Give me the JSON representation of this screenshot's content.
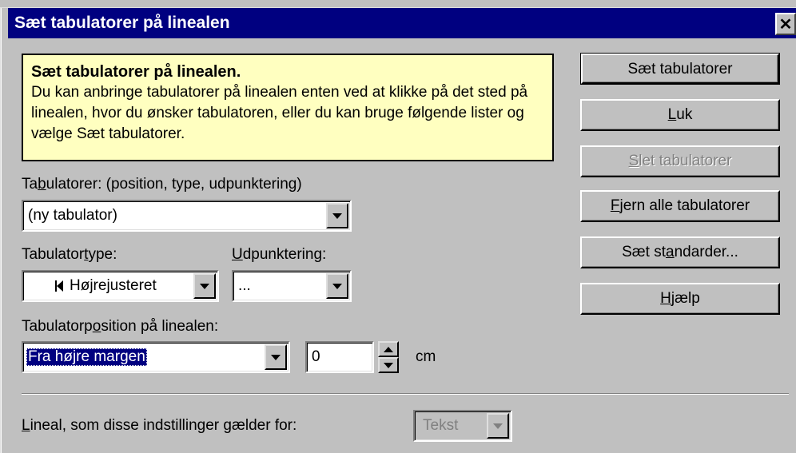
{
  "dialog": {
    "title": "Sæt tabulatorer på linealen",
    "close_label": "✕"
  },
  "tip": {
    "title": "Sæt tabulatorer på linealen.",
    "body": "Du kan anbringe tabulatorer på linealen enten ved at klikke på det sted på linealen, hvor du ønsker tabulatoren, eller du kan bruge følgende lister og vælge Sæt tabulatorer."
  },
  "tabs_list": {
    "label_pre": "Ta",
    "label_u": "b",
    "label_post": "ulatorer: (position, type, udpunktering)",
    "value": "(ny tabulator)"
  },
  "tab_type": {
    "label_pre": "Tabulator",
    "label_u": "t",
    "label_post": "ype:",
    "value": "Højrejusteret"
  },
  "leader": {
    "label_pre": "",
    "label_u": "U",
    "label_post": "dpunktering:",
    "value": "..."
  },
  "position": {
    "label_pre": "Tabulatorp",
    "label_u": "o",
    "label_post": "sition på linealen:",
    "from_value": "Fra højre margen",
    "number_value": "0",
    "unit": "cm"
  },
  "ruler": {
    "label_pre": "",
    "label_u": "L",
    "label_post": "ineal, som disse indstillinger gælder for:",
    "value": "Tekst"
  },
  "buttons": {
    "set_tabs": "Sæt tabulatorer",
    "close_pre": "",
    "close_u": "L",
    "close_post": "uk",
    "delete_pre": "",
    "delete_u": "S",
    "delete_post": "let tabulatorer",
    "remove_all_pre": "",
    "remove_all_u": "F",
    "remove_all_post": "jern alle tabulatorer",
    "defaults_pre": "Sæt st",
    "defaults_u": "a",
    "defaults_post": "ndarder...",
    "help_pre": "",
    "help_u": "H",
    "help_post": "jælp"
  }
}
